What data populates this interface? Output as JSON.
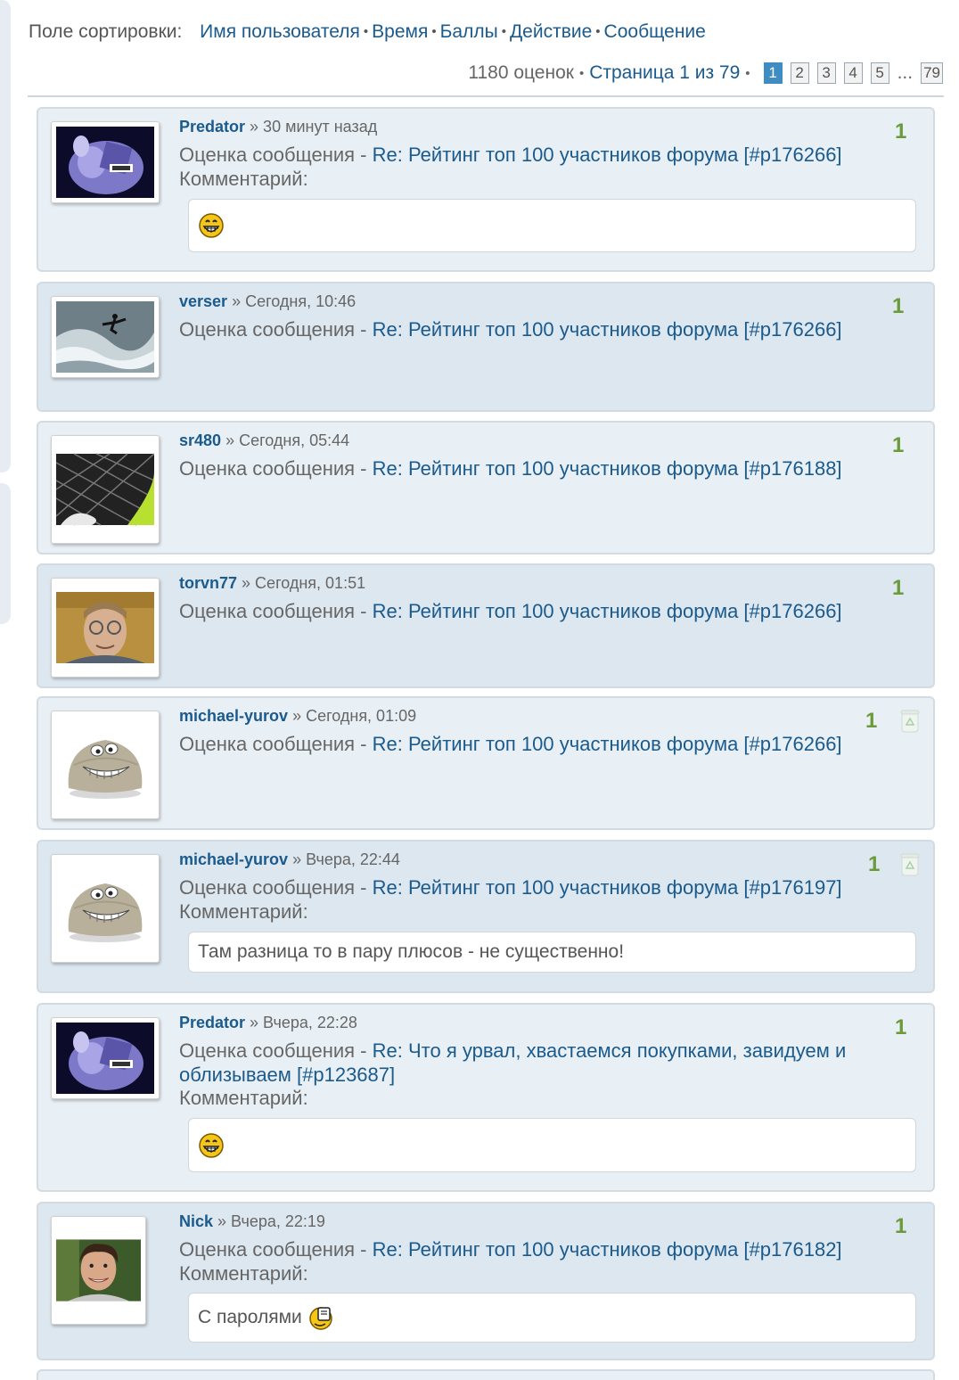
{
  "sort": {
    "label": "Поле сортировки:",
    "options": [
      "Имя пользователя",
      "Время",
      "Баллы",
      "Действие",
      "Сообщение"
    ]
  },
  "pager": {
    "count": "1180 оценок",
    "page_text": "Страница 1 из 79",
    "pages": [
      "1",
      "2",
      "3",
      "4",
      "5"
    ],
    "ellipsis": "...",
    "last": "79",
    "current": "1"
  },
  "entries": [
    {
      "user": "Predator",
      "time": "» 30 минут назад",
      "prefix": "Оценка сообщения - ",
      "post": "Re: Рейтинг топ 100 участников форума [#p176266]",
      "comment_label": "Комментарий:",
      "comment": "",
      "comment_icon": "grin-smiley-icon",
      "score": "1",
      "avatar": "purple-cartoon-avatar"
    },
    {
      "user": "verser",
      "time": "» Сегодня, 10:46",
      "prefix": "Оценка сообщения - ",
      "post": "Re: Рейтинг топ 100 участников форума [#p176266]",
      "score": "1",
      "avatar": "surfer-wave-avatar"
    },
    {
      "user": "sr480",
      "time": "» Сегодня, 05:44",
      "prefix": "Оценка сообщения - ",
      "post": "Re: Рейтинг топ 100 участников форума [#p176188]",
      "score": "1",
      "avatar": "fishnet-avatar"
    },
    {
      "user": "torvn77",
      "time": "» Сегодня, 01:51",
      "prefix": "Оценка сообщения - ",
      "post": "Re: Рейтинг топ 100 участников форума [#p176266]",
      "score": "1",
      "avatar": "man-glasses-avatar"
    },
    {
      "user": "michael-yurov",
      "time": "» Сегодня, 01:09",
      "prefix": "Оценка сообщения - ",
      "post": "Re: Рейтинг топ 100 участников форума [#p176266]",
      "score": "1",
      "avatar": "stone-smiley-avatar",
      "trash": "recycle-bin-icon"
    },
    {
      "user": "michael-yurov",
      "time": "» Вчера, 22:44",
      "prefix": "Оценка сообщения - ",
      "post": "Re: Рейтинг топ 100 участников форума [#p176197]",
      "comment_label": "Комментарий:",
      "comment": "Там разница то в пару плюсов - не существенно!",
      "score": "1",
      "avatar": "stone-smiley-avatar",
      "trash": "recycle-bin-icon"
    },
    {
      "user": "Predator",
      "time": "» Вчера, 22:28",
      "prefix": "Оценка сообщения - ",
      "post": "Re: Что я урвал, хвастаемся покупками, завидуем и облизываем [#p123687]",
      "comment_label": "Комментарий:",
      "comment": "",
      "comment_icon": "grin-smiley-icon",
      "score": "1",
      "avatar": "purple-cartoon-avatar"
    },
    {
      "user": "Nick",
      "time": "» Вчера, 22:19",
      "prefix": "Оценка сообщения - ",
      "post": "Re: Рейтинг топ 100 участников форума [#p176182]",
      "comment_label": "Комментарий:",
      "comment": "С паролями",
      "comment_icon": "drinking-smiley-icon",
      "score": "1",
      "avatar": "young-man-avatar"
    }
  ]
}
